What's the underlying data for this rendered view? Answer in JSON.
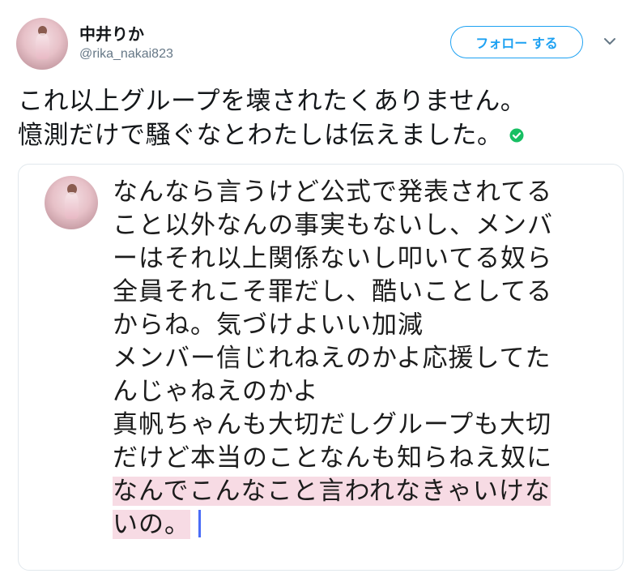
{
  "user": {
    "name": "中井りか",
    "handle": "@rika_nakai823"
  },
  "header": {
    "follow_label": "フォロー する"
  },
  "tweet": {
    "lines": [
      "これ以上グループを壊されたくありません。",
      "憶測だけで騒ぐなとわたしは伝えました。"
    ]
  },
  "attachment": {
    "lines": [
      "なんなら言うけど公式で発表されてる",
      "こと以外なんの事実もないし、メンバ",
      "ーはそれ以上関係ないし叩いてる奴ら",
      "全員それこそ罪だし、酷いことしてる",
      "からね。気づけよいい加減",
      "メンバー信じれねえのかよ応援してた",
      "んじゃねえのかよ",
      "真帆ちゃんも大切だしグループも大切",
      "だけど本当のことなんも知らねえ奴に",
      "なんでこんなこと言われなきゃいけな",
      "いの。"
    ]
  },
  "colors": {
    "accent": "#1da1f2",
    "verified": "#17bf63",
    "highlight": "#f7dbe4",
    "caret": "#4a6cf7"
  },
  "icons": {
    "more": "chevron-down-icon",
    "verified": "check-circle-icon"
  }
}
